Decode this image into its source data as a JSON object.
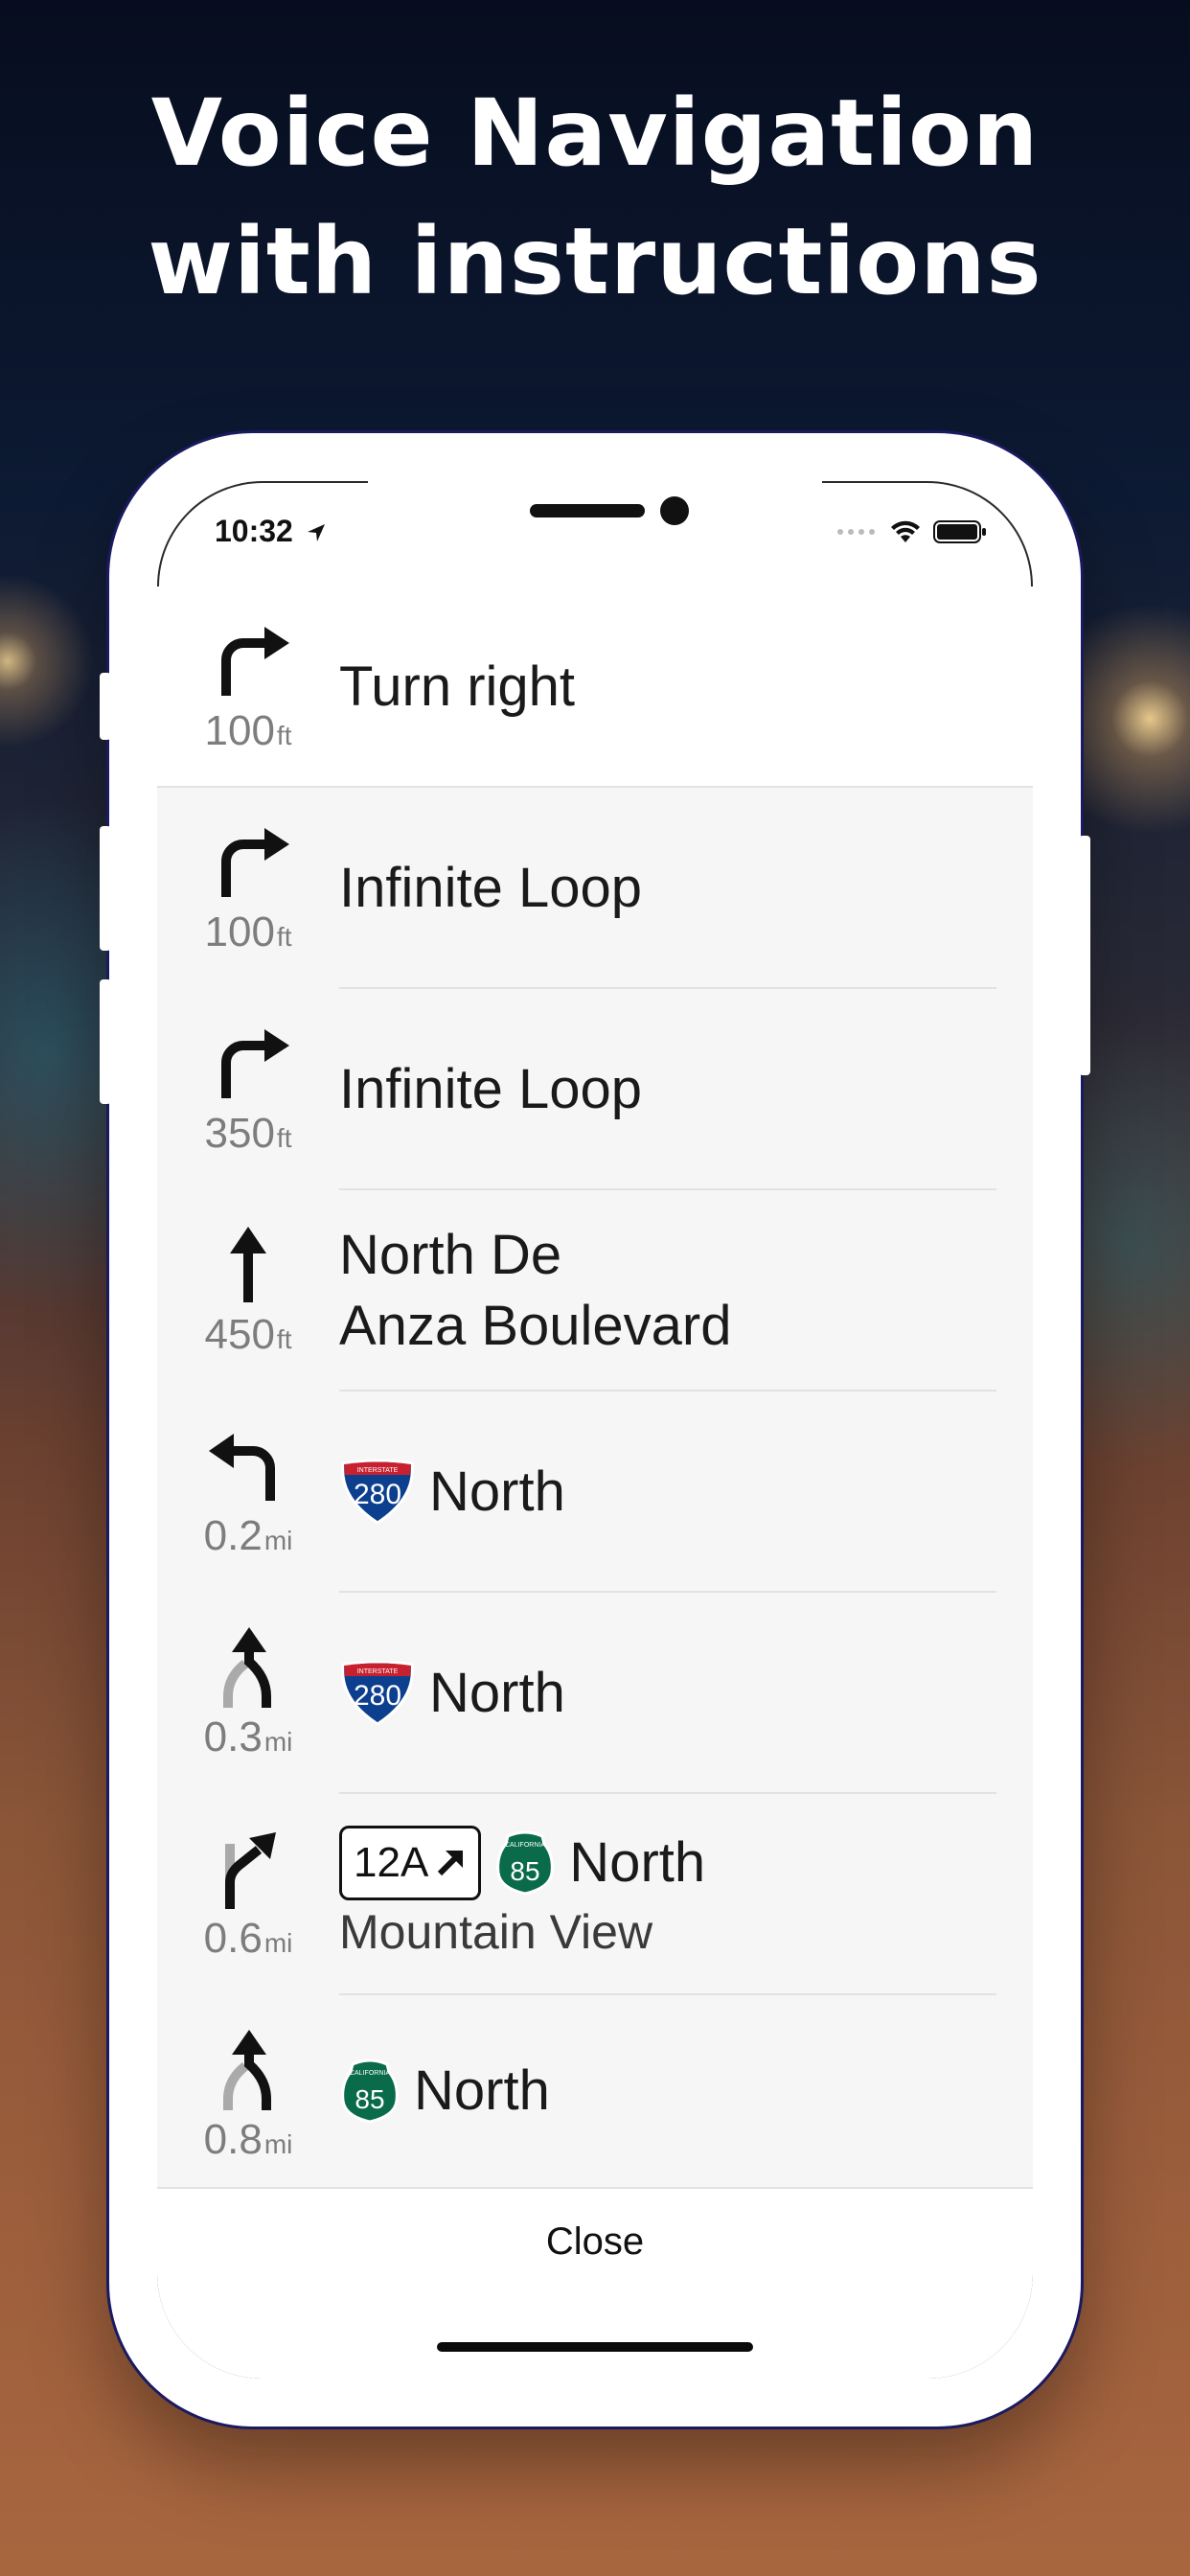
{
  "headline": {
    "line1": "Voice Navigation",
    "line2": "with instructions"
  },
  "status_bar": {
    "time": "10:32",
    "icons": [
      "location-arrow-icon",
      "cellular-icon",
      "wifi-icon",
      "battery-icon"
    ]
  },
  "steps": [
    {
      "maneuver": "turn-right-icon",
      "distance": "100",
      "unit": "ft",
      "text": "Turn right"
    },
    {
      "maneuver": "turn-right-icon",
      "distance": "100",
      "unit": "ft",
      "text": "Infinite Loop"
    },
    {
      "maneuver": "turn-right-icon",
      "distance": "350",
      "unit": "ft",
      "text": "Infinite Loop"
    },
    {
      "maneuver": "straight-icon",
      "distance": "450",
      "unit": "ft",
      "line1": "North De",
      "line2": "Anza Boulevard"
    },
    {
      "maneuver": "turn-left-icon",
      "distance": "0.2",
      "unit": "mi",
      "shield": {
        "type": "interstate",
        "number": "280",
        "top": "INTERSTATE"
      },
      "text": "North"
    },
    {
      "maneuver": "merge-icon",
      "distance": "0.3",
      "unit": "mi",
      "shield": {
        "type": "interstate",
        "number": "280",
        "top": "INTERSTATE"
      },
      "text": "North"
    },
    {
      "maneuver": "exit-right-icon",
      "distance": "0.6",
      "unit": "mi",
      "exit": "12A",
      "shield": {
        "type": "california",
        "number": "85",
        "top": "CALIFORNIA"
      },
      "text": "North",
      "subtext": "Mountain View"
    },
    {
      "maneuver": "merge-icon",
      "distance": "0.8",
      "unit": "mi",
      "shield": {
        "type": "california",
        "number": "85",
        "top": "CALIFORNIA"
      },
      "text": "North"
    }
  ],
  "close_button": "Close",
  "colors": {
    "interstate_blue": "#0d3f8f",
    "interstate_red": "#c7202e",
    "ca_green": "#0a6b4a"
  }
}
